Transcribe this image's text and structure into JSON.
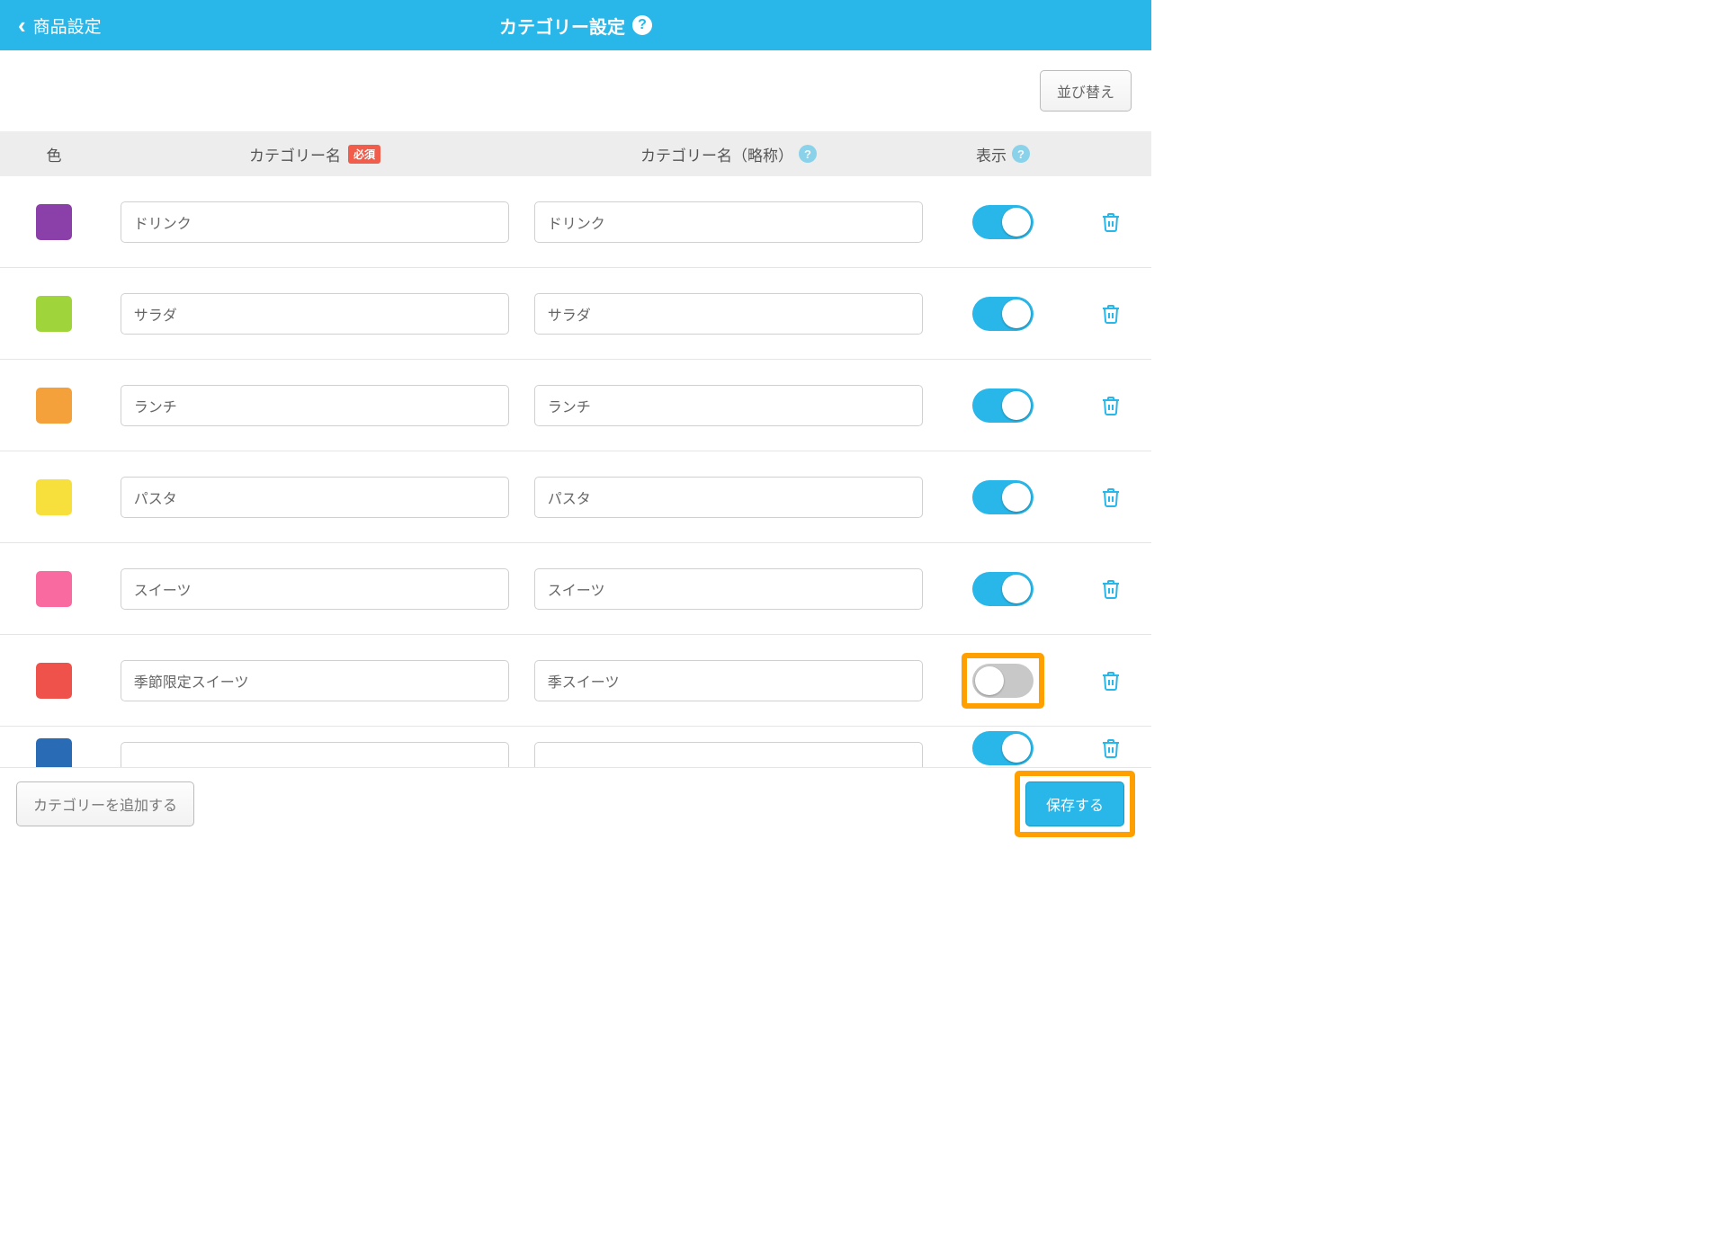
{
  "header": {
    "back_label": "商品設定",
    "title": "カテゴリー設定"
  },
  "toolbar": {
    "sort_label": "並び替え"
  },
  "columns": {
    "color": "色",
    "name": "カテゴリー名",
    "required_badge": "必須",
    "short": "カテゴリー名（略称）",
    "display": "表示"
  },
  "rows": [
    {
      "color": "#8b3fa8",
      "name": "ドリンク",
      "short": "ドリンク",
      "display": true,
      "highlighted": false
    },
    {
      "color": "#9fd53a",
      "name": "サラダ",
      "short": "サラダ",
      "display": true,
      "highlighted": false
    },
    {
      "color": "#f5a13b",
      "name": "ランチ",
      "short": "ランチ",
      "display": true,
      "highlighted": false
    },
    {
      "color": "#f7e03c",
      "name": "パスタ",
      "short": "パスタ",
      "display": true,
      "highlighted": false
    },
    {
      "color": "#f86aa0",
      "name": "スイーツ",
      "short": "スイーツ",
      "display": true,
      "highlighted": false
    },
    {
      "color": "#ef514b",
      "name": "季節限定スイーツ",
      "short": "季スイーツ",
      "display": false,
      "highlighted": true
    }
  ],
  "partial_row": {
    "color": "#2a6bb5"
  },
  "footer": {
    "add_label": "カテゴリーを追加する",
    "save_label": "保存する"
  }
}
